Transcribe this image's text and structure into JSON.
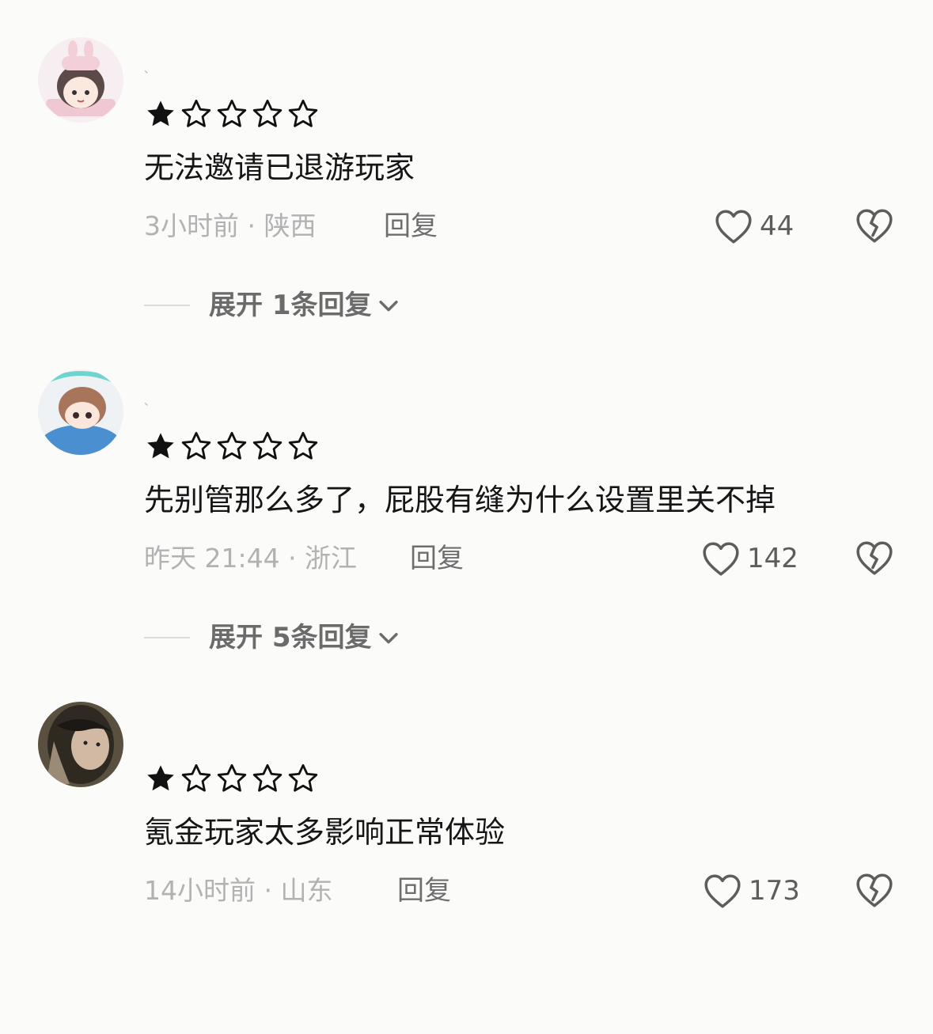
{
  "comments": [
    {
      "username": "、",
      "rating": 1,
      "rating_max": 5,
      "text": "无法邀请已退游玩家",
      "time": "3小时前",
      "location": "陕西",
      "meta_text": "3小时前 · 陕西",
      "reply_label": "回复",
      "likes": "44",
      "expand_label": "展开 1条回复",
      "avatar_icon": "anime-girl-avatar"
    },
    {
      "username": "、",
      "rating": 1,
      "rating_max": 5,
      "text": "先别管那么多了，屁股有缝为什么设置里关不掉",
      "time": "昨天 21:44",
      "location": "浙江",
      "meta_text": "昨天 21:44 · 浙江",
      "reply_label": "回复",
      "likes": "142",
      "expand_label": "展开 5条回复",
      "avatar_icon": "anime-boy-avatar"
    },
    {
      "username": "",
      "rating": 1,
      "rating_max": 5,
      "text": "氪金玩家太多影响正常体验",
      "time": "14小时前",
      "location": "山东",
      "meta_text": "14小时前 · 山东",
      "reply_label": "回复",
      "likes": "173",
      "avatar_icon": "photo-avatar"
    }
  ],
  "colors": {
    "background": "#fbfbfa",
    "text": "#161616",
    "meta": "#b2b2b2",
    "reply": "#6e6e6e",
    "icon": "#5d5d5d"
  }
}
